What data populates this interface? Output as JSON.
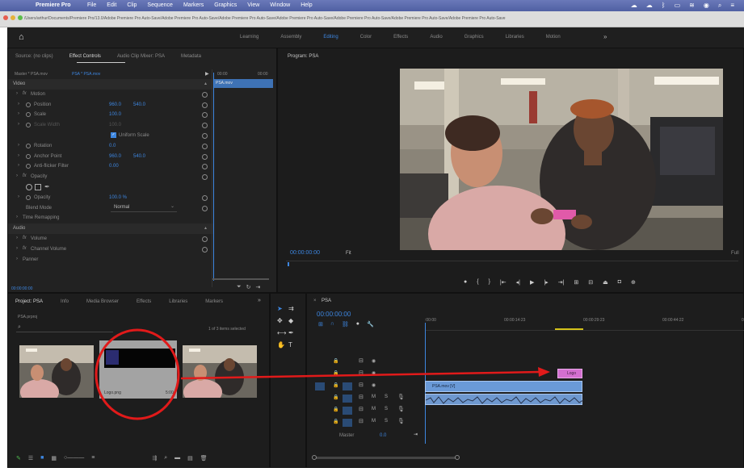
{
  "menubar": {
    "apple": "",
    "app": "Premiere Pro",
    "items": [
      "File",
      "Edit",
      "Clip",
      "Sequence",
      "Markers",
      "Graphics",
      "View",
      "Window",
      "Help"
    ]
  },
  "pathbar": {
    "path": "/Users/arthur/Documents/Premiere Pro/13.0/Adobe Premiere Pro Auto-Save/Adobe Premiere Pro Auto-Save/Adobe Premiere Pro Auto-Save/Adobe Premiere Pro Auto-Save/Adobe Premiere Pro Auto-Save/Adobe Premiere Pro Auto-Save/Adobe Premiere Pro Auto-Save"
  },
  "workspaces": [
    "Learning",
    "Assembly",
    "Editing",
    "Color",
    "Effects",
    "Audio",
    "Graphics",
    "Libraries",
    "Motion"
  ],
  "source_tabs": [
    "Source: (no clips)",
    "Effect Controls",
    "Audio Clip Mixer: PSA",
    "Metadata"
  ],
  "effect_controls": {
    "master": "Master * PSA.mov",
    "clip": "PSA * PSA.mov",
    "time_left": "00:00",
    "time_right": "00:00",
    "clip_label": "PSA.mov",
    "video": "Video",
    "motion": "Motion",
    "position": {
      "label": "Position",
      "x": "960.0",
      "y": "540.0"
    },
    "scale": {
      "label": "Scale",
      "v": "100.0"
    },
    "scale_width": {
      "label": "Scale Width",
      "v": "100.0"
    },
    "uniform": "Uniform Scale",
    "rotation": {
      "label": "Rotation",
      "v": "0.0"
    },
    "anchor": {
      "label": "Anchor Point",
      "x": "960.0",
      "y": "540.0"
    },
    "antiflicker": {
      "label": "Anti-flicker Filter",
      "v": "0.00"
    },
    "opacity": "Opacity",
    "opacity_val": {
      "label": "Opacity",
      "v": "100.0 %"
    },
    "blend": {
      "label": "Blend Mode",
      "v": "Normal"
    },
    "time_remap": "Time Remapping",
    "audio": "Audio",
    "volume": "Volume",
    "channel": "Channel Volume",
    "panner": "Panner",
    "timecode": "00:00:00:00"
  },
  "program": {
    "title": "Program: PSA",
    "timecode": "00:00:00:00",
    "fit": "Fit",
    "full": "Full"
  },
  "project": {
    "tabs": [
      "Project: PSA",
      "Info",
      "Media Browser",
      "Effects",
      "Libraries",
      "Markers"
    ],
    "file": "PSA.prproj",
    "count": "1 of 3 items selected",
    "item_name": "Logo.png",
    "item_dur": "5:00"
  },
  "timeline": {
    "tab": "PSA",
    "timecode": "00:00:00:00",
    "ruler": [
      ":00:00",
      "00:00:14:23",
      "00:00:29:23",
      "00:00:44:22",
      "00:00"
    ],
    "master": "Master",
    "master_val": "0.0",
    "logo_clip": "Logo",
    "video_clip": "PSA.mov [V]"
  },
  "colors": {
    "accent": "#3d86e0",
    "magenta": "#c86ec8",
    "annotation": "#e11a1a",
    "menubar": "#5d6fb0"
  }
}
